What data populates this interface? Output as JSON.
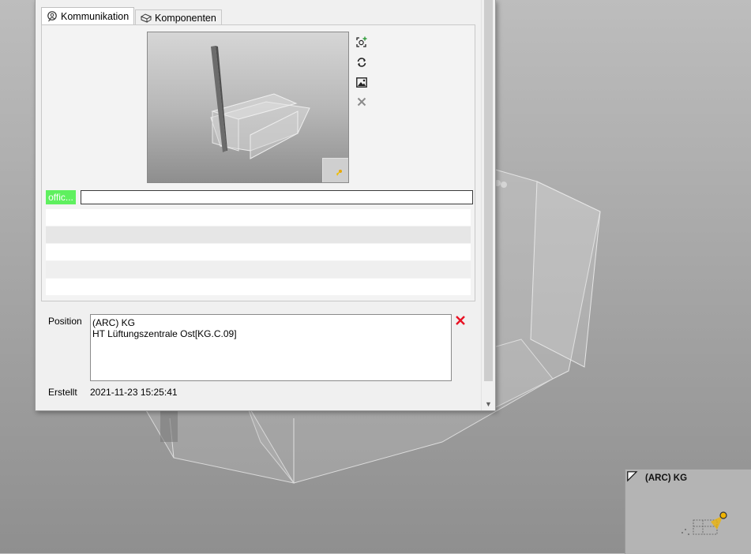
{
  "tabs": [
    {
      "label": "Kommunikation",
      "icon": "chat-user-icon",
      "active": true
    },
    {
      "label": "Komponenten",
      "icon": "component-box-icon",
      "active": false
    }
  ],
  "preview": {
    "actions": [
      {
        "icon": "add-viewpoint-icon"
      },
      {
        "icon": "refresh-icon"
      },
      {
        "icon": "image-icon"
      },
      {
        "icon": "close-icon"
      }
    ]
  },
  "tag": {
    "badge": "offic...",
    "badge_color": "#5ff05f",
    "input_value": ""
  },
  "form": {
    "position_label": "Position",
    "position_lines": [
      "(ARC) KG",
      "HT Lüftungszentrale Ost[KG.C.09]"
    ],
    "created_label": "Erstellt",
    "created_value": "2021-11-23 15:25:41",
    "clear_color": "#e81123"
  },
  "minimap": {
    "label": "(ARC) KG",
    "marker_color": "#f0b400"
  }
}
